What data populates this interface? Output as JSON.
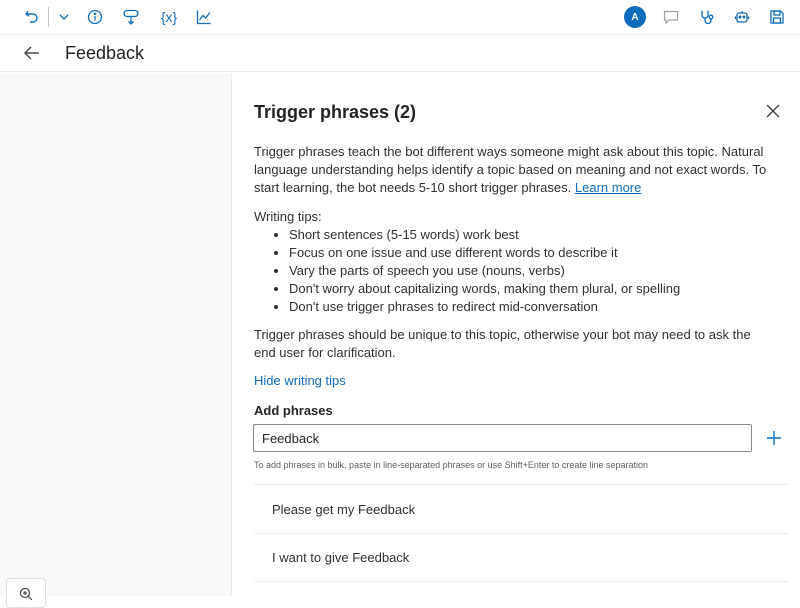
{
  "toolbar": {
    "icons": [
      "undo-icon",
      "chevron-down-icon",
      "info-icon",
      "trigger-icon",
      "variables-icon",
      "analytics-icon"
    ],
    "variables_label": "{x}",
    "right_icons": [
      "avatar",
      "chat-icon",
      "stethoscope-icon",
      "bot-icon",
      "save-icon"
    ],
    "avatar_initial": "A",
    "accent_color": "#0f6cbd"
  },
  "header": {
    "back_icon": "arrow-left-icon",
    "title": "Feedback"
  },
  "panel": {
    "title": "Trigger phrases (2)",
    "close_icon": "close-icon",
    "description": "Trigger phrases teach the bot different ways someone might ask about this topic. Natural language understanding helps identify a topic based on meaning and not exact words. To start learning, the bot needs 5-10 short trigger phrases.",
    "learn_more": "Learn more",
    "tips_label": "Writing tips:",
    "tips": [
      "Short sentences (5-15 words) work best",
      "Focus on one issue and use different words to describe it",
      "Vary the parts of speech you use (nouns, verbs)",
      "Don't worry about capitalizing words, making them plural, or spelling",
      "Don't use trigger phrases to redirect mid-conversation"
    ],
    "unique_note": "Trigger phrases should be unique to this topic, otherwise your bot may need to ask the end user for clarification.",
    "hide_tips": "Hide writing tips",
    "add_label": "Add phrases",
    "input_value": "Feedback",
    "add_icon": "plus-icon",
    "hint": "To add phrases in bulk, paste in line-separated phrases or use Shift+Enter to create line separation",
    "phrases": [
      "Please get my Feedback",
      "I want to give Feedback"
    ]
  },
  "canvas": {
    "zoom_icon": "zoom-in-icon"
  }
}
